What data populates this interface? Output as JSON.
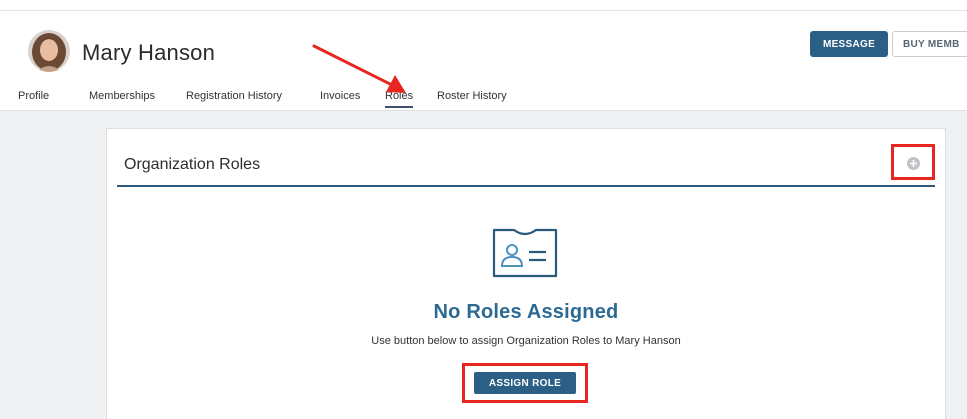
{
  "user": {
    "name": "Mary Hanson"
  },
  "header": {
    "message_label": "MESSAGE",
    "buy_label": "BUY MEMB"
  },
  "tabs": [
    {
      "label": "Profile"
    },
    {
      "label": "Memberships"
    },
    {
      "label": "Registration History"
    },
    {
      "label": "Invoices"
    },
    {
      "label": "Roles",
      "active": true
    },
    {
      "label": "Roster History"
    }
  ],
  "card": {
    "title": "Organization Roles",
    "add_icon": "plus-circle-icon",
    "empty_state": {
      "icon": "id-card-icon",
      "title": "No Roles Assigned",
      "subtitle": "Use button below to assign Organization Roles to Mary Hanson",
      "button_label": "ASSIGN ROLE"
    }
  },
  "colors": {
    "primary": "#2b5f86",
    "accent_title": "#2c6a94",
    "annotation_red": "#e8261f",
    "content_bg": "#eef0f2"
  }
}
